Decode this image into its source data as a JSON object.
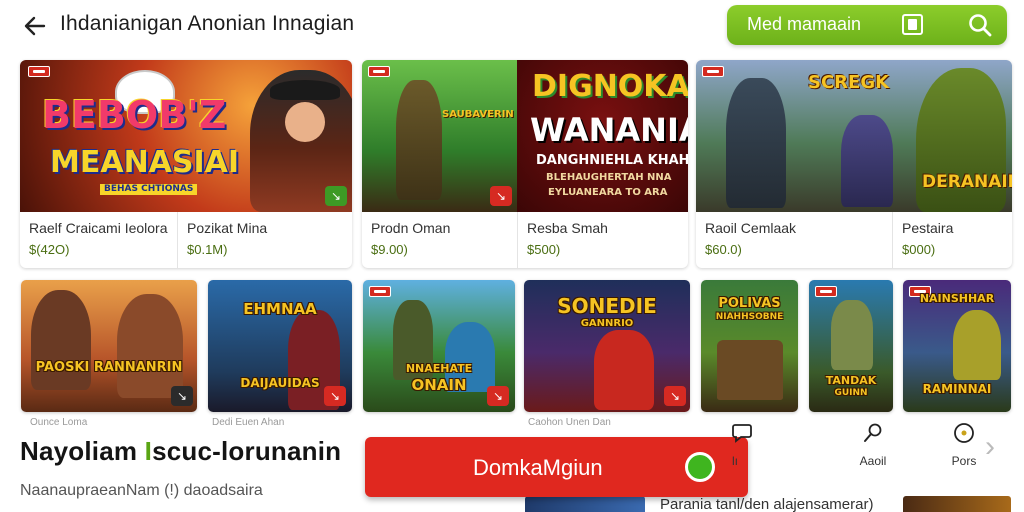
{
  "header": {
    "title": "Ihdanianigan Anonian Innagian",
    "back_icon": "arrow-left-icon",
    "search_label": "Med mamaain",
    "accent_color": "#7cc023"
  },
  "featured": [
    {
      "art_lines": [
        "BEBOB'Z",
        "MEANASIAI",
        "BEHAS CHTIONAS"
      ],
      "columns": [
        {
          "name": "Raelf Craicami Ieolora",
          "price": "$(42O)"
        },
        {
          "name": "Pozikat Mina",
          "price": "$0.1M)"
        }
      ]
    },
    {
      "art_lines": [
        "SAUBAVERIN",
        "DIGNOKAE",
        "WANANIA",
        "DANGHNIEHLA KHAH",
        "BLEHAUGHERTAH NNA",
        "EYLUANEARA TO ARA"
      ],
      "columns": [
        {
          "name": "Prodn Oman",
          "price": "$9.00)"
        },
        {
          "name": "Resba Smah",
          "price": "$500)"
        }
      ]
    },
    {
      "art_lines": [
        "SCREGK",
        "DERANAIN"
      ],
      "columns": [
        {
          "name": "Raoil Cemlaak",
          "price": "$60.0)"
        },
        {
          "name": "Pestaira",
          "price": "$000)"
        }
      ]
    }
  ],
  "tiles": [
    {
      "title": "PAOSKI RANNANRIN"
    },
    {
      "title": "EHMNAA",
      "title2": "DAIJAUIDAS"
    },
    {
      "title": "NNAEHATE",
      "title2": "ONAIN"
    },
    {
      "title": "SONEDIE",
      "title2": "GANNRIO"
    },
    {
      "title": "POLIVAS",
      "title2": "NIAHHSOBNE"
    },
    {
      "title": "TANDAK",
      "title2": "GUINN"
    },
    {
      "title": "NAINSHHAR",
      "title2": "RAMINNAI"
    }
  ],
  "ghost_labels": [
    "Ounce Loma",
    "Dedi Euen Ahan",
    "Caohon Unen Dan"
  ],
  "section": {
    "title_a": "Nayoliam ",
    "title_accent": "I",
    "title_b": "scuc-lorunanin",
    "subtitle": "NaanaupraeanNam (!) daoadsaira"
  },
  "cta": {
    "label": "DomkaMgiun"
  },
  "nav": [
    {
      "icon": "chat-icon",
      "label": "lı"
    },
    {
      "icon": "magnifier-icon",
      "label": "Aaoil"
    },
    {
      "icon": "coin-icon",
      "label": "Pors"
    }
  ],
  "peek_text": "Parania tanl/den alajensamerar)"
}
